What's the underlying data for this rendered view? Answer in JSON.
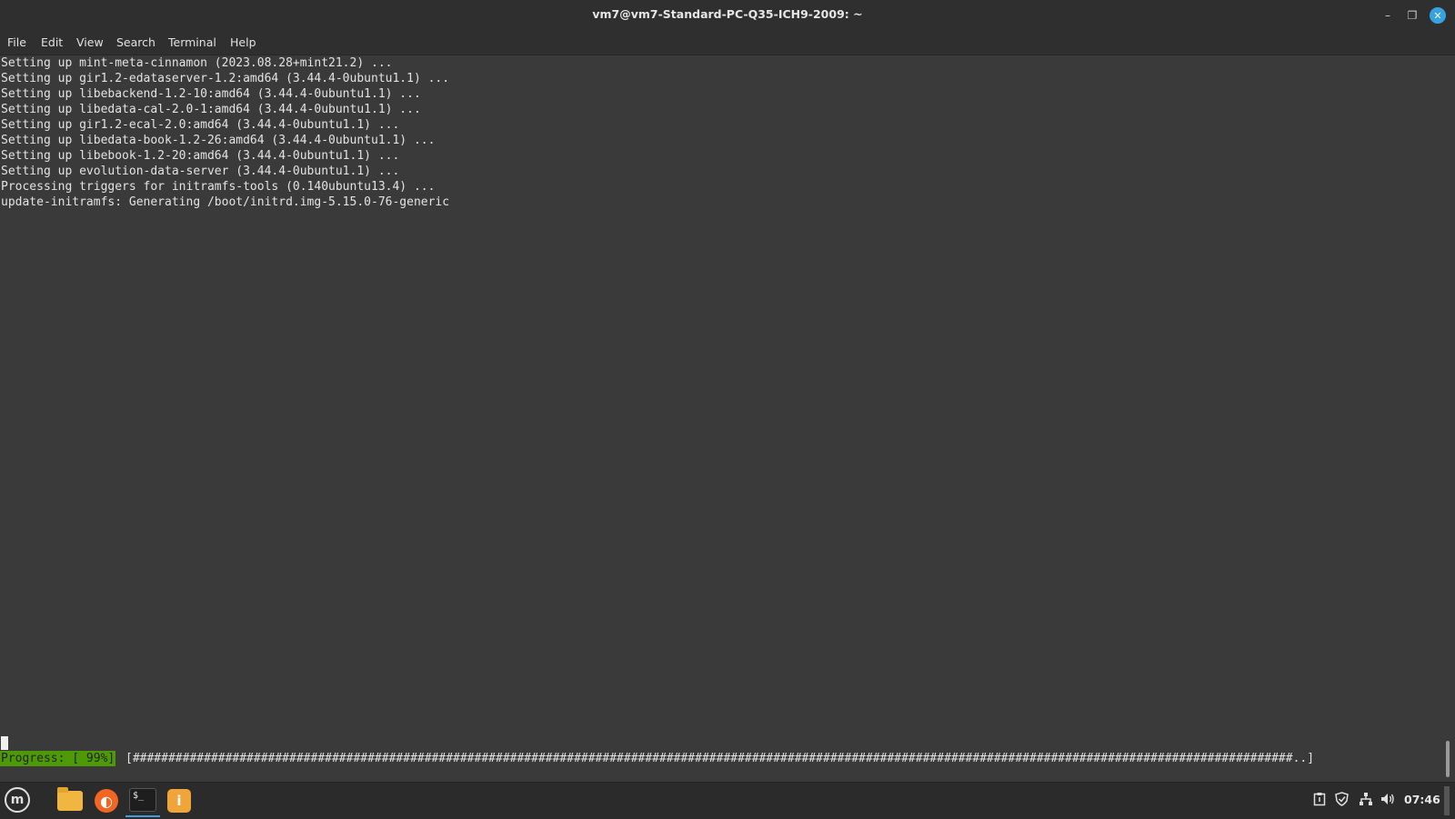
{
  "window": {
    "title": "vm7@vm7-Standard-PC-Q35-ICH9-2009: ~",
    "minimize_glyph": "–",
    "maximize_glyph": "❐",
    "close_glyph": "✕"
  },
  "menu": {
    "items": [
      "File",
      "Edit",
      "View",
      "Search",
      "Terminal",
      "Help"
    ]
  },
  "terminal": {
    "lines": [
      "Setting up mint-meta-cinnamon (2023.08.28+mint21.2) ...",
      "Setting up gir1.2-edataserver-1.2:amd64 (3.44.4-0ubuntu1.1) ...",
      "Setting up libebackend-1.2-10:amd64 (3.44.4-0ubuntu1.1) ...",
      "Setting up libedata-cal-2.0-1:amd64 (3.44.4-0ubuntu1.1) ...",
      "Setting up gir1.2-ecal-2.0:amd64 (3.44.4-0ubuntu1.1) ...",
      "Setting up libedata-book-1.2-26:amd64 (3.44.4-0ubuntu1.1) ...",
      "Setting up libebook-1.2-20:amd64 (3.44.4-0ubuntu1.1) ...",
      "Setting up evolution-data-server (3.44.4-0ubuntu1.1) ...",
      "Processing triggers for initramfs-tools (0.140ubuntu13.4) ...",
      "update-initramfs: Generating /boot/initrd.img-5.15.0-76-generic"
    ],
    "progress_label": "Progress: [ 99%]",
    "progress_bar": "[###################################################################################################################################################################..]",
    "progress_color": "#4e9a06"
  },
  "taskbar": {
    "apps": [
      {
        "name": "file-manager",
        "icon": "folder-icon"
      },
      {
        "name": "firefox",
        "icon": "firefox-icon"
      },
      {
        "name": "terminal",
        "icon": "terminal-icon",
        "active": true
      },
      {
        "name": "update-manager",
        "icon": "update-manager-icon"
      }
    ],
    "terminal_icon_text": "$_",
    "clock": "07:46",
    "tray_icons": [
      "clipboard-icon",
      "shield-icon",
      "network-icon",
      "volume-icon"
    ]
  },
  "colors": {
    "terminal_bg": "#3a3a3a",
    "titlebar_bg": "#2f2f2f",
    "accent": "#36a3e0"
  }
}
